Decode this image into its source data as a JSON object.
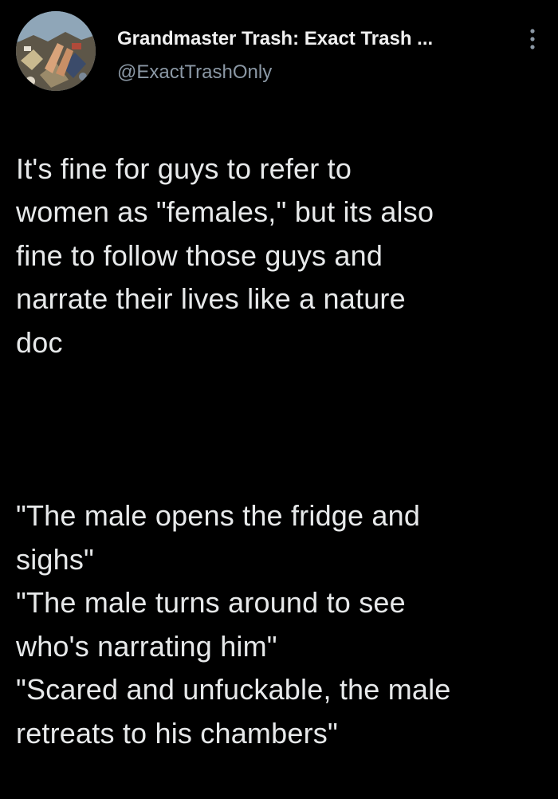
{
  "author": {
    "display_name": "Grandmaster Trash: Exact Trash ...",
    "handle": "@ExactTrashOnly",
    "avatar_icon": "avatar-photo-icon"
  },
  "menu": {
    "more_icon": "vertical-ellipsis-icon"
  },
  "tweet": {
    "paragraph_1": "It's fine for guys to refer to\nwomen as \"females,\" but its also\nfine to follow those guys and\nnarrate their lives like a nature\ndoc",
    "paragraph_2": "\"The male opens the fridge and\nsighs\"\n\"The male turns around to see\nwho's narrating him\"\n\"Scared and unfuckable, the male\nretreats to his chambers\""
  },
  "colors": {
    "background": "#000000",
    "text": "#e7e9ea",
    "secondary_text": "#8b98a5"
  }
}
